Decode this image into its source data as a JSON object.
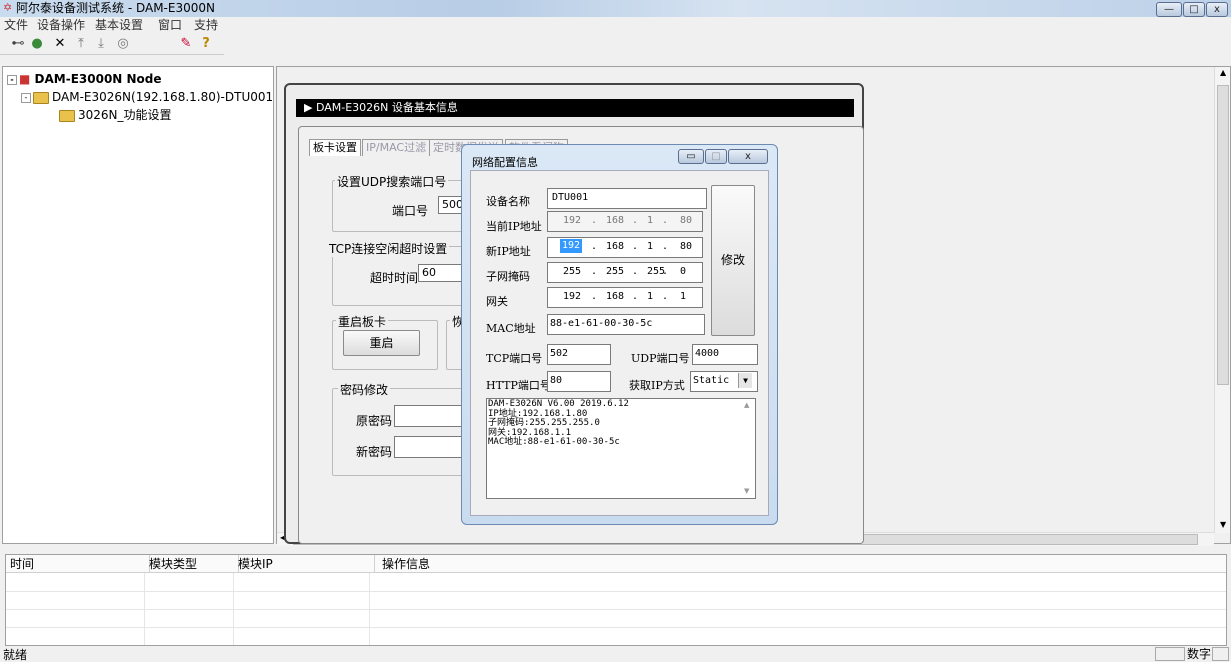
{
  "window": {
    "title": "阿尔泰设备测试系统 - DAM-E3000N"
  },
  "menu": [
    "文件",
    "设备操作",
    "基本设置",
    "窗口",
    "支持"
  ],
  "tree": {
    "root": "DAM-E3000N Node",
    "device": "DAM-E3026N(192.168.1.80)-DTU001",
    "child": "3026N_功能设置"
  },
  "panel": {
    "header": "DAM-E3026N 设备基本信息",
    "tabs": [
      "板卡设置",
      "IP/MAC过滤",
      "定时数据发送",
      "软件看门狗"
    ],
    "udp_group": "设置UDP搜索端口号",
    "port_label": "端口号",
    "port_value": "5001",
    "tcp_group": "TCP连接空闲超时设置",
    "timeout_label": "超时时间",
    "timeout_value": "60",
    "restart_group": "重启板卡",
    "restart_button": "重启",
    "restore_group": "恢",
    "password_group": "密码修改",
    "old_pw_label": "原密码",
    "new_pw_label": "新密码"
  },
  "dialog": {
    "title": "网络配置信息",
    "device_name_label": "设备名称",
    "device_name": "DTU001",
    "cur_ip_label": "当前IP地址",
    "cur_ip": [
      "192",
      "168",
      "1",
      "80"
    ],
    "new_ip_label": "新IP地址",
    "new_ip": [
      "192",
      "168",
      "1",
      "80"
    ],
    "mask_label": "子网掩码",
    "mask": [
      "255",
      "255",
      "255",
      "0"
    ],
    "gateway_label": "网关",
    "gateway": [
      "192",
      "168",
      "1",
      "1"
    ],
    "mac_label": "MAC地址",
    "mac": "88-e1-61-00-30-5c",
    "modify_button": "修改",
    "tcp_port_label": "TCP端口号",
    "tcp_port": "502",
    "udp_port_label": "UDP端口号",
    "udp_port": "4000",
    "http_port_label": "HTTP端口号",
    "http_port": "80",
    "ip_mode_label": "获取IP方式",
    "ip_mode": "Static",
    "info_lines": [
      "DAM-E3026N V6.00 2019.6.12",
      "IP地址:192.168.1.80",
      "子网掩码:255.255.255.0",
      "网关:192.168.1.1",
      "MAC地址:88-e1-61-00-30-5c"
    ]
  },
  "log": {
    "columns": [
      "时间",
      "模块类型",
      "模块IP",
      "操作信息"
    ]
  },
  "statusbar": {
    "left": "就绪",
    "right": "数字"
  }
}
